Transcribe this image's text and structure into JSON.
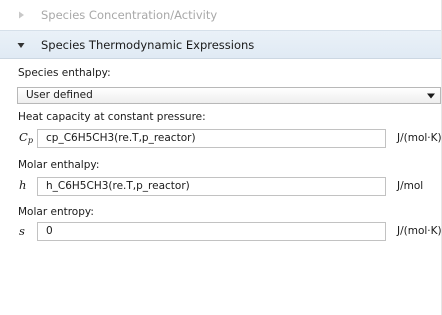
{
  "sections": {
    "collapsed_title": "Species Concentration/Activity",
    "expanded_title": "Species Thermodynamic Expressions"
  },
  "enthalpy_mode": {
    "label": "Species enthalpy:",
    "selected": "User defined"
  },
  "heat_capacity": {
    "label": "Heat capacity at constant pressure:",
    "symbol": "C",
    "symbol_sub": "p",
    "value": "cp_C6H5CH3(re.T,p_reactor)",
    "unit": "J/(mol·K)"
  },
  "molar_enthalpy": {
    "label": "Molar enthalpy:",
    "symbol": "h",
    "value": "h_C6H5CH3(re.T,p_reactor)",
    "unit": "J/mol"
  },
  "molar_entropy": {
    "label": "Molar entropy:",
    "symbol": "s",
    "value": "0",
    "unit": "J/(mol·K)"
  },
  "icons": {
    "collapsed_caret": "caret-right-icon",
    "expanded_caret": "caret-down-icon",
    "combo_arrow": "dropdown-arrow-icon"
  },
  "colors": {
    "header_bg": "#e0eaf4",
    "collapsed_text": "#a8a8a8"
  }
}
